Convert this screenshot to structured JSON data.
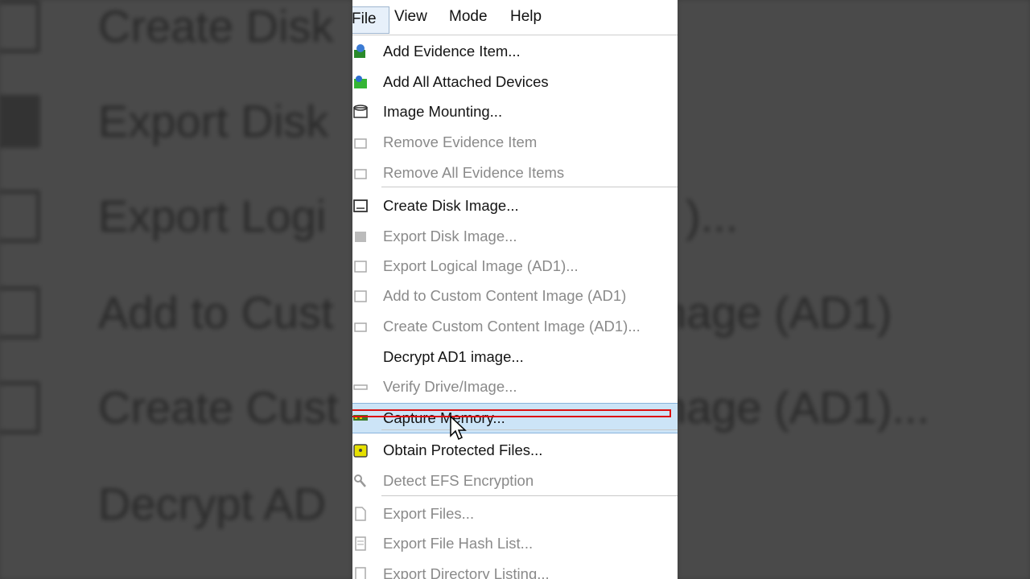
{
  "menubar": {
    "items": [
      {
        "label": "File"
      },
      {
        "label": "View"
      },
      {
        "label": "Mode"
      },
      {
        "label": "Help"
      }
    ]
  },
  "file_menu": {
    "items": [
      {
        "label": "Add Evidence Item...",
        "enabled": true,
        "icon": "add-evidence-icon"
      },
      {
        "label": "Add All Attached Devices",
        "enabled": true,
        "icon": "add-devices-icon"
      },
      {
        "label": "Image Mounting...",
        "enabled": true,
        "icon": "image-mount-icon"
      },
      {
        "label": "Remove Evidence Item",
        "enabled": false,
        "icon": "remove-evidence-icon"
      },
      {
        "label": "Remove All Evidence Items",
        "enabled": false,
        "icon": "remove-all-icon"
      },
      {
        "label": "Create Disk Image...",
        "enabled": true,
        "icon": "create-disk-image-icon"
      },
      {
        "label": "Export Disk Image...",
        "enabled": false,
        "icon": "export-disk-image-icon"
      },
      {
        "label": "Export Logical Image (AD1)...",
        "enabled": false,
        "icon": "export-logical-image-icon"
      },
      {
        "label": "Add to Custom Content Image (AD1)",
        "enabled": false,
        "icon": "add-custom-content-icon"
      },
      {
        "label": "Create Custom Content Image (AD1)...",
        "enabled": false,
        "icon": "create-custom-content-icon"
      },
      {
        "label": "Decrypt AD1 image...",
        "enabled": true,
        "icon": ""
      },
      {
        "label": "Verify Drive/Image...",
        "enabled": false,
        "icon": "verify-drive-icon"
      },
      {
        "label": "Capture Memory...",
        "enabled": true,
        "icon": "capture-memory-icon",
        "highlighted": true
      },
      {
        "label": "Obtain Protected Files...",
        "enabled": true,
        "icon": "obtain-files-icon"
      },
      {
        "label": "Detect EFS Encryption",
        "enabled": false,
        "icon": "detect-efs-icon"
      },
      {
        "label": "Export Files...",
        "enabled": false,
        "icon": "export-files-icon"
      },
      {
        "label": "Export File Hash List...",
        "enabled": false,
        "icon": "export-hash-icon"
      },
      {
        "label": "Export Directory Listing...",
        "enabled": false,
        "icon": "export-directory-icon"
      }
    ]
  },
  "background": {
    "rows": [
      "Create Disk",
      "Export Disk",
      "Export Logi",
      "Add to Cust",
      "Create Cust",
      "Decrypt AD"
    ],
    "right_rows": [
      ")...",
      "nage (AD1)",
      "nage (AD1)..."
    ]
  },
  "colors": {
    "highlight": "#cce4f7",
    "disabled_text": "#8a8a8a",
    "annotation_red": "#d11111"
  }
}
